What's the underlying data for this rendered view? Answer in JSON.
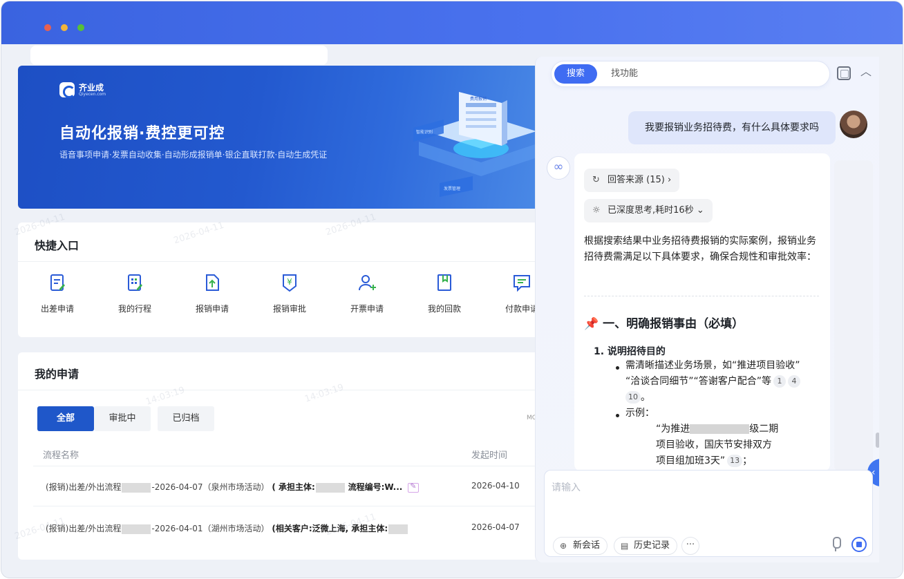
{
  "banner": {
    "brand_name": "齐业成",
    "brand_sub": "Qiyecen.com",
    "title": "自动化报销·费控更可控",
    "subtitle": "语音事项申请·发票自动收集·自动形成报销单·银企直联打款·自动生成凭证",
    "illus_labels": [
      "费用报销",
      "智能识别",
      "发票管理"
    ]
  },
  "quick": {
    "title": "快捷入口",
    "items": [
      {
        "label": "出差申请",
        "icon": "edit-doc-icon"
      },
      {
        "label": "我的行程",
        "icon": "grid-doc-icon"
      },
      {
        "label": "报销申请",
        "icon": "upload-doc-icon"
      },
      {
        "label": "报销审批",
        "icon": "yen-shield-icon"
      },
      {
        "label": "开票申请",
        "icon": "add-user-icon"
      },
      {
        "label": "我的回款",
        "icon": "bookmark-icon"
      },
      {
        "label": "付款申请",
        "icon": "message-doc-icon"
      }
    ]
  },
  "apps": {
    "title": "我的申请",
    "tabs": [
      "全部",
      "审批中",
      "已归档"
    ],
    "more_hint": "MC",
    "columns": [
      "流程名称",
      "发起时间"
    ],
    "rows": [
      {
        "name_a": "(报销)出差/外出流程",
        "name_b": "-2026-04-07（泉州市场活动）",
        "bold_a": "( 承担主体:",
        "bold_b": "流程编号:W...",
        "date": "2026-04-10"
      },
      {
        "name_a": "(报销)出差/外出流程",
        "name_b": "-2026-04-01（湖州市场活动）",
        "bold_a": "(相关客户:泛微上海, 承担主体:",
        "bold_b": "",
        "date": "2026-04-07"
      }
    ]
  },
  "watermark": {
    "date": "2026-04-11",
    "time": "14:03:19"
  },
  "chat": {
    "tabs": {
      "search": "搜索",
      "func": "找功能"
    },
    "user_message": "我要报销业务招待费，有什么具体要求吗",
    "sources": "回答来源 (15)",
    "thinking": "已深度思考,耗时16秒",
    "intro": "根据搜索结果中业务招待费报销的实际案例，报销业务招待费需满足以下具体要求，确保合规性和审批效率：",
    "section_title": "一、明确报销事由（必填）",
    "item1_title": "1. 说明招待目的",
    "bullet1_line1": "需清晰描述业务场景，如“推进项目验收”",
    "bullet1_line2": "“洽谈合同细节”“答谢客户配合”等",
    "cites1": [
      "1",
      "4",
      "10"
    ],
    "bullet1_end": "。",
    "bullet2": "示例：",
    "example_l1a": "“为推进",
    "example_l1b": "级二期",
    "example_l2": "项目验收，国庆节安排双方",
    "example_l3": "项目组加班3天”",
    "cite_ex": "13",
    "example_end": "；",
    "input_placeholder": "请输入",
    "new_chat": "新会话",
    "history": "历史记录",
    "more": "···"
  },
  "colors": {
    "titlebar": "#3a63e0",
    "accent": "#3f6cf2",
    "tab_active": "#1f57c9"
  }
}
